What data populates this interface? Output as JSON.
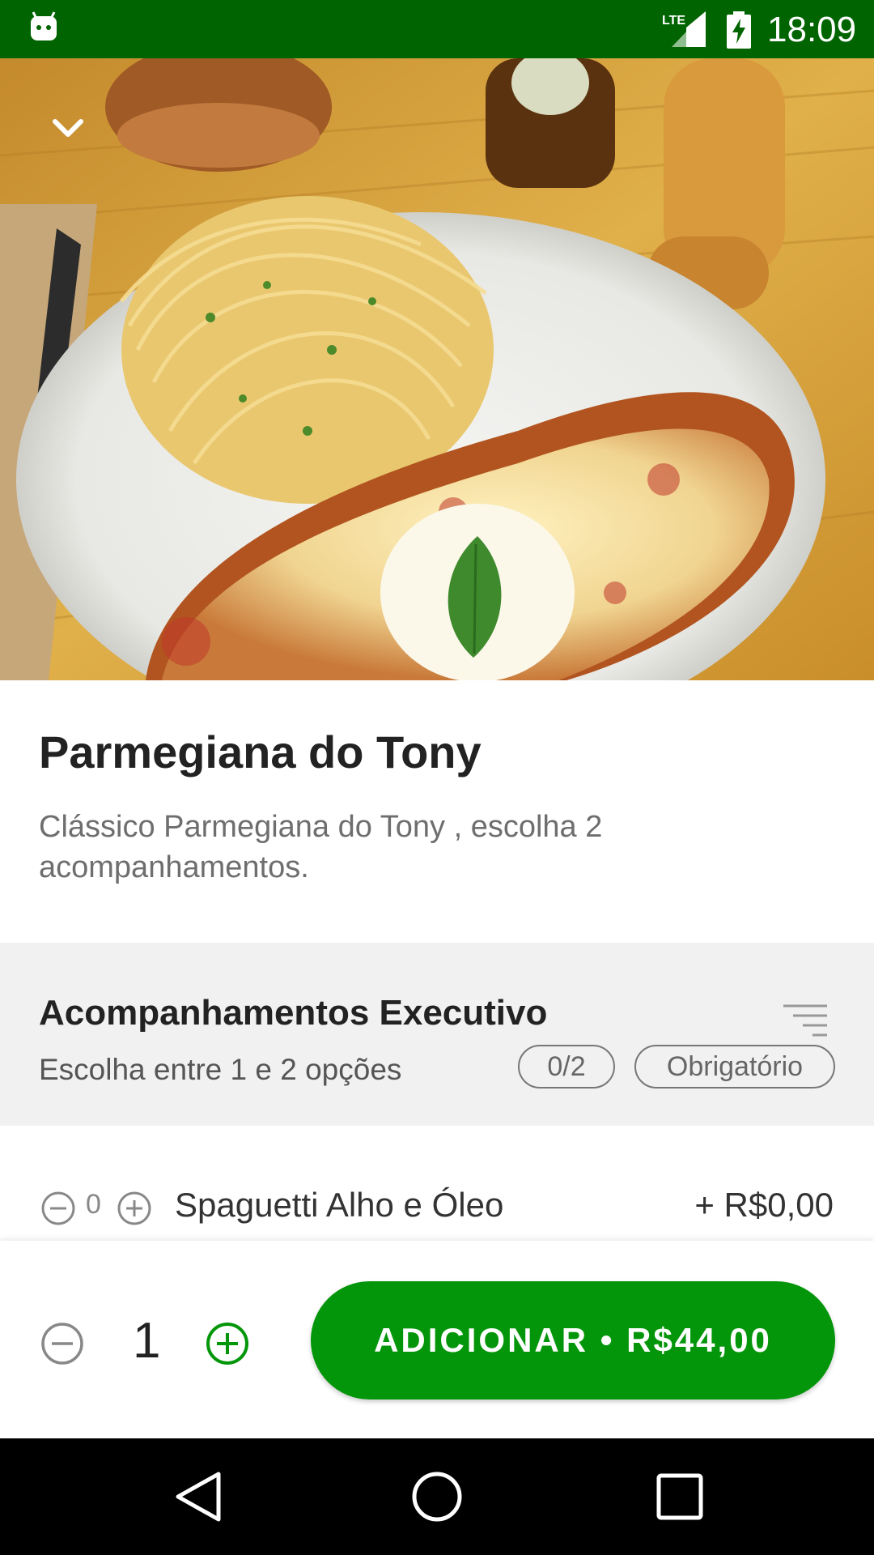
{
  "status_bar": {
    "time": "18:09",
    "network": "LTE",
    "icons": [
      "android-app-icon",
      "lte-signal-icon",
      "battery-charging-icon"
    ]
  },
  "hero": {
    "image_description_icon": "food-photo",
    "collapse_icon": "chevron-down-icon"
  },
  "product": {
    "title": "Parmegiana do Tony",
    "description": "Clássico Parmegiana do Tony , escolha 2 acompanhamentos."
  },
  "group": {
    "title": "Acompanhamentos Executivo",
    "subtitle": "Escolha entre 1 e 2 opções",
    "count": "0/2",
    "required_badge": "Obrigatório",
    "sort_icon": "sort-lines-icon"
  },
  "options": [
    {
      "quantity": "0",
      "name": "Spaguetti Alho e Óleo",
      "price": "+ R$0,00"
    }
  ],
  "order": {
    "quantity": "1",
    "add_button_label": "ADICIONAR • R$44,00"
  },
  "colors": {
    "status_bar": "#006400",
    "primary_green": "#04960a",
    "nav_bar": "#000000"
  }
}
